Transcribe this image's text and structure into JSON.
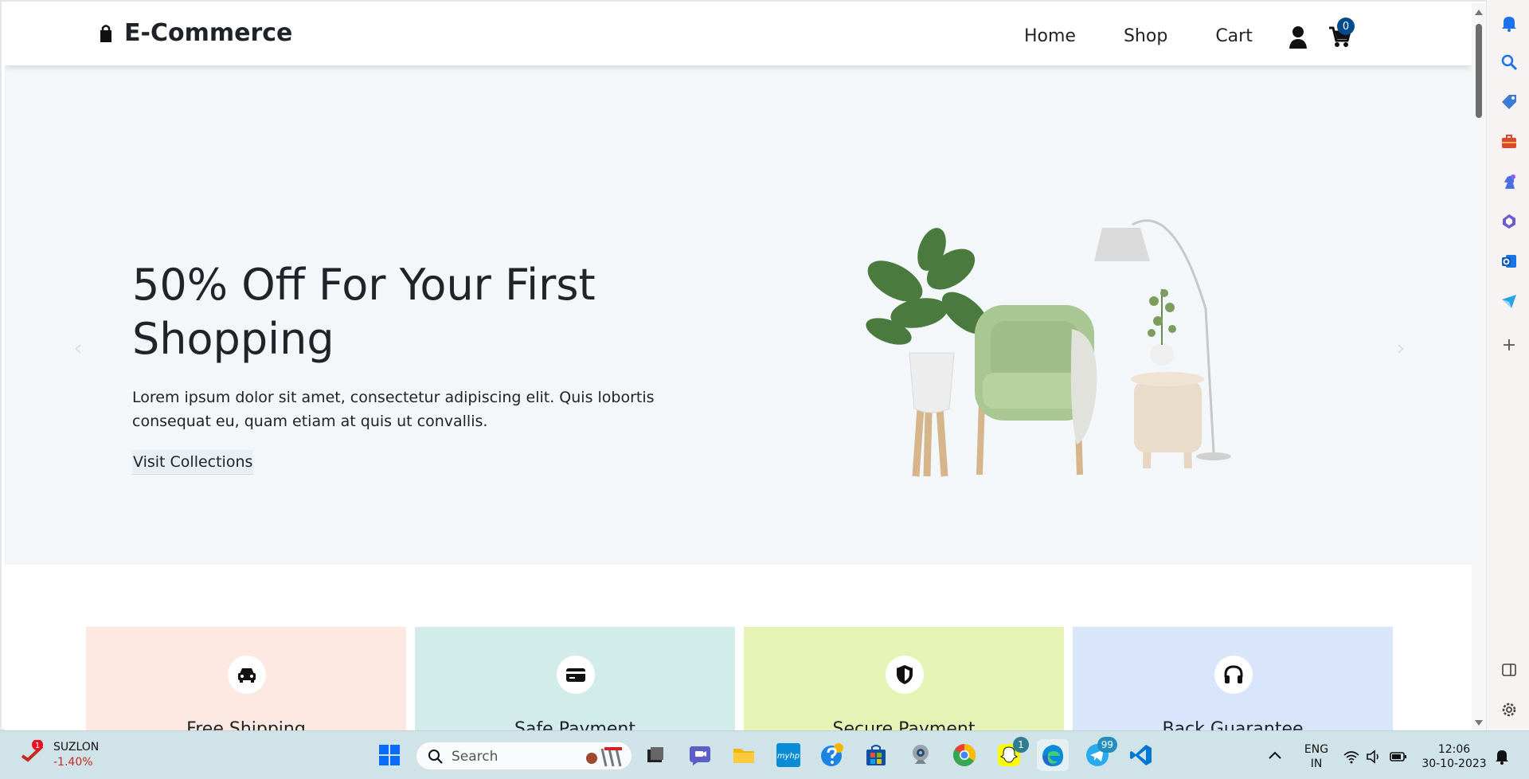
{
  "site": {
    "brand": "E-Commerce",
    "nav": [
      {
        "label": "Home"
      },
      {
        "label": "Shop"
      },
      {
        "label": "Cart"
      }
    ],
    "cart_count": "0"
  },
  "hero": {
    "heading": "50% Off For Your First Shopping",
    "text": "Lorem ipsum dolor sit amet, consectetur adipiscing elit. Quis lobortis consequat eu, quam etiam at quis ut convallis.",
    "button": "Visit Collections",
    "prev": "‹",
    "next": "›"
  },
  "features": [
    {
      "title": "Free Shipping",
      "icon": "car-icon",
      "color": "#fde9e1"
    },
    {
      "title": "Safe Payment",
      "icon": "card-icon",
      "color": "#d2ecea"
    },
    {
      "title": "Secure Payment",
      "icon": "shield-icon",
      "color": "#e5f3b4"
    },
    {
      "title": "Back Guarantee",
      "icon": "headphones-icon",
      "color": "#d9e5fb"
    }
  ],
  "edge_sidebar": {
    "icons": [
      "bell-icon",
      "search-icon",
      "tag-icon",
      "briefcase-icon",
      "chess-icon",
      "copilot-icon",
      "outlook-icon",
      "send-icon",
      "plus-icon",
      "sidebar-toggle-icon",
      "settings-icon"
    ]
  },
  "taskbar": {
    "stock": {
      "name": "SUZLON",
      "change": "-1.40%",
      "alert": "1"
    },
    "search_placeholder": "Search",
    "apps": [
      {
        "name": "windows-icon"
      },
      {
        "name": "file-manager-icon"
      },
      {
        "name": "teams-chat-icon"
      },
      {
        "name": "folder-icon"
      },
      {
        "name": "myhp-icon",
        "label": "myhp"
      },
      {
        "name": "help-icon"
      },
      {
        "name": "store-icon"
      },
      {
        "name": "camera-icon"
      },
      {
        "name": "chrome-icon"
      },
      {
        "name": "snapchat-icon",
        "badge": "1"
      },
      {
        "name": "edge-icon"
      },
      {
        "name": "telegram-icon",
        "badge": "99"
      },
      {
        "name": "vscode-icon"
      }
    ],
    "language": {
      "top": "ENG",
      "bottom": "IN"
    },
    "time": "12:06",
    "date": "30-10-2023"
  }
}
